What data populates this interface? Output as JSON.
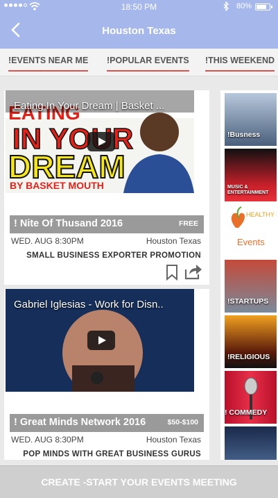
{
  "status": {
    "time": "18:50 PM",
    "battery": "80%"
  },
  "header": {
    "title": "Houston  Texas"
  },
  "tabs": [
    {
      "label": "!EVENTS NEAR ME"
    },
    {
      "label": "!POPULAR EVENTS"
    },
    {
      "label": "!THIS WEEKEND"
    }
  ],
  "events": [
    {
      "video_title": "Eating In Your Dream | Basket ...",
      "thumb_text": [
        "EATING",
        "IN YOUR",
        "DREAM",
        "BY BASKET MOUTH"
      ],
      "name": "! Nite Of Thusand 2016",
      "price": "FREE",
      "date": "WED. AUG 8:30PM",
      "location": "Houston  Texas",
      "description": "SMALL BUSINESS EXPORTER  PROMOTION"
    },
    {
      "video_title": "Gabriel Iglesias - Work for Disn..",
      "name": "! Great  Minds Network 2016",
      "price": "$50-$100",
      "date": "WED. AUG 8:30PM",
      "location": "Houston  Texas",
      "description": "POP MINDS WITH GREAT BUSINESS GURUS"
    }
  ],
  "categories": [
    {
      "label": "!Busness"
    },
    {
      "label": "MUSIC & ENTERTAINMENT"
    },
    {
      "label": "Events",
      "logo_text": "HEALTHY FUTURES"
    },
    {
      "label": "!STARTUPS"
    },
    {
      "label": "!RELIGIOUS"
    },
    {
      "label": "! COMMEDY"
    },
    {
      "label": ""
    }
  ],
  "cta": {
    "label": "CREATE -START  YOUR EVENTS MEETING"
  },
  "colors": {
    "header": "#a6b8eb",
    "accent": "#d9534f",
    "banner": "#9a9a9a",
    "cta": "#cfcfcf"
  }
}
